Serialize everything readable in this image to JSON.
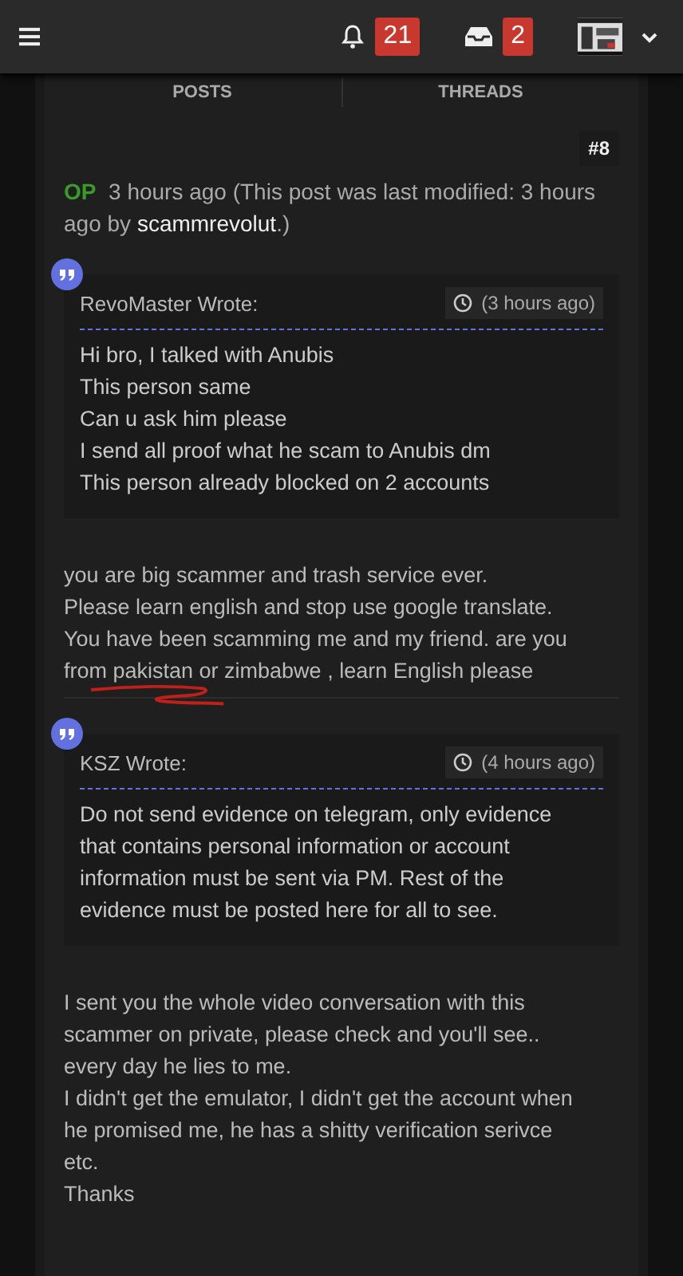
{
  "header": {
    "notifications": {
      "count": "21"
    },
    "messages": {
      "count": "2"
    }
  },
  "tabs": [
    {
      "label": "POSTS"
    },
    {
      "label": "THREADS"
    }
  ],
  "post": {
    "number": "#8",
    "op_badge": "OP",
    "time": "3 hours ago (This post was last modified: 3 hours ago",
    "by": "by",
    "author": "scammrevolut",
    "by_end": ".)",
    "blocks": [
      {
        "kind": "quote",
        "author": "RevoMaster Wrote:",
        "time": "(3 hours ago)",
        "text": "Hi bro, I talked with Anubis\nThis person same\nCan u ask him please\nI send all proof what he scam to Anubis dm\nThis person already blocked on 2 accounts"
      },
      {
        "kind": "text",
        "text": "you are big scammer and trash service ever.\nPlease learn english and stop use google translate.\nYou have been scamming  me and my friend. are you\nfrom pakistan or zimbabwe , learn English please",
        "scribble": true
      },
      {
        "kind": "quote",
        "author": "KSZ Wrote:",
        "time": "(4 hours ago)",
        "text": "Do not send evidence on telegram, only evidence\nthat contains personal information or account\ninformation must be sent via PM. Rest of the\nevidence must be posted here for all to see."
      },
      {
        "kind": "text",
        "text": "I sent you the whole video conversation with this\nscammer on private, please check and you'll see..\nevery day he lies to me.\nI didn't get the emulator, I didn't get the account when\nhe promised me, he has a shitty verification serivce\netc.\nThanks",
        "scribble": false
      }
    ]
  }
}
